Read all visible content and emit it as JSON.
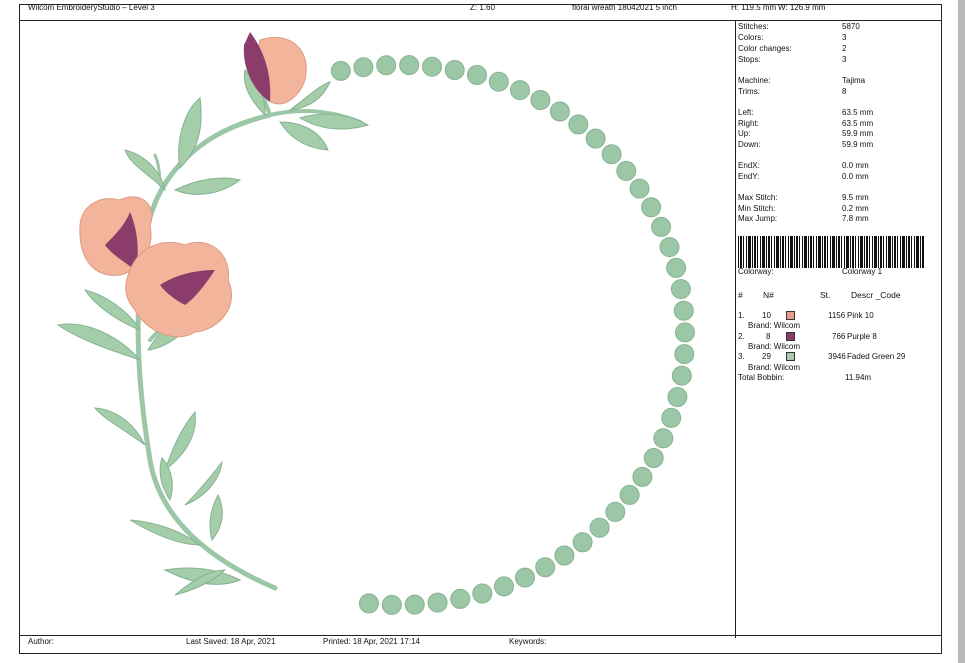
{
  "header": {
    "app_title": "Wilcom EmbroideryStudio – Level 3",
    "zoom": "Z: 1.60",
    "design_name": "floral wreath 18042021  5 inch",
    "height": "H: 119.5 mm",
    "width": "W: 126.9 mm"
  },
  "stats": {
    "stitches_label": "Stitches:",
    "stitches": "5870",
    "colors_label": "Colors:",
    "colors": "3",
    "color_changes_label": "Color changes:",
    "color_changes": "2",
    "stops_label": "Stops:",
    "stops": "3",
    "machine_label": "Machine:",
    "machine": "Tajima",
    "trims_label": "Trims:",
    "trims": "8",
    "left_label": "Left:",
    "left": "63.5 mm",
    "right_label": "Right:",
    "right": "63.5 mm",
    "up_label": "Up:",
    "up": "59.9 mm",
    "down_label": "Down:",
    "down": "59.9 mm",
    "endx_label": "EndX:",
    "endx": "0.0 mm",
    "endy_label": "EndY:",
    "endy": "0.0 mm",
    "max_stitch_label": "Max Stitch:",
    "max_stitch": "9.5 mm",
    "min_stitch_label": "Min Stitch:",
    "min_stitch": "0.2 mm",
    "max_jump_label": "Max Jump:",
    "max_jump": "7.8 mm"
  },
  "colorway": {
    "label": "Colorway:",
    "value": "Colorway 1"
  },
  "table": {
    "headers": {
      "index": "#",
      "n": "N#",
      "st": "St.",
      "desc": "Descr _Code"
    },
    "rows": [
      {
        "index": "1.",
        "n": "10",
        "swatch": "#e89a8f",
        "st": "1156",
        "desc": "Pink 10",
        "brand": "Brand: Wilcom"
      },
      {
        "index": "2.",
        "n": "8",
        "swatch": "#8a3b6a",
        "st": "766",
        "desc": "Purple 8",
        "brand": "Brand: Wilcom"
      },
      {
        "index": "3.",
        "n": "29",
        "swatch": "#a9c8ae",
        "st": "3946",
        "desc": "Faded Green 29",
        "brand": "Brand: Wilcom"
      }
    ],
    "total_label": "Total Bobbin:",
    "total_value": "11.94m"
  },
  "footer": {
    "author": "Author:",
    "last_saved": "Last Saved: 18 Apr, 2021",
    "printed": "Printed: 18 Apr, 2021 17:14",
    "keywords": "Keywords:"
  },
  "colors": {
    "pink": "#f2b59c",
    "purple": "#8b3c6b",
    "green": "#9cc7a6"
  }
}
